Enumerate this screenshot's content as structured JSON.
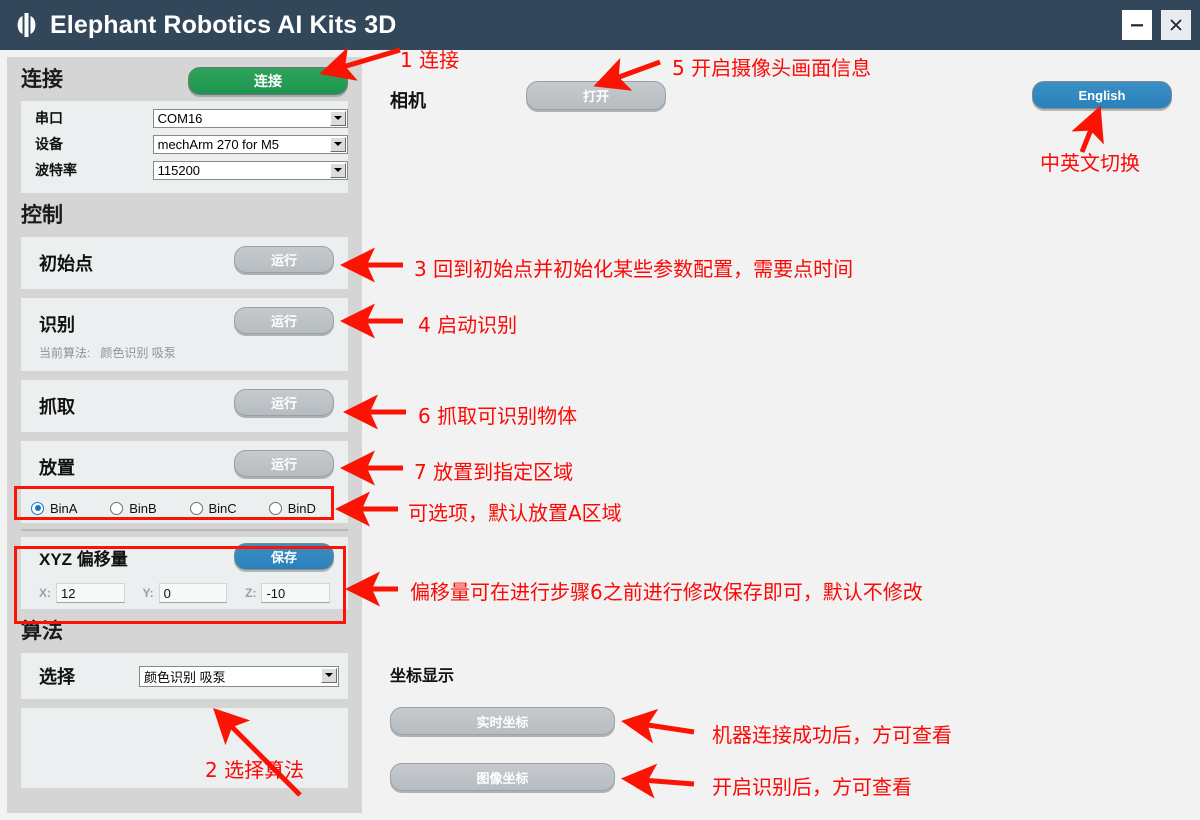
{
  "window": {
    "title": "Elephant Robotics AI Kits 3D",
    "logo_icon": "elephant-robotics-logo",
    "minimize_icon": "minimize-icon",
    "close_icon": "close-icon"
  },
  "sidebar": {
    "connection": {
      "heading": "连接",
      "connect_button": "连接",
      "fields": [
        {
          "label": "串口",
          "value": "COM16"
        },
        {
          "label": "设备",
          "value": "mechArm 270 for M5"
        },
        {
          "label": "波特率",
          "value": "115200"
        }
      ]
    },
    "control": {
      "heading": "控制",
      "run_label": "运行",
      "actions": [
        {
          "name": "初始点"
        },
        {
          "name": "识别"
        },
        {
          "name": "抓取"
        },
        {
          "name": "放置"
        }
      ],
      "current_algorithm_label": "当前算法:",
      "current_algorithm_value": "颜色识别 吸泵",
      "bins": [
        {
          "label": "BinA",
          "selected": true
        },
        {
          "label": "BinB",
          "selected": false
        },
        {
          "label": "BinC",
          "selected": false
        },
        {
          "label": "BinD",
          "selected": false
        }
      ]
    },
    "offset": {
      "heading": "XYZ 偏移量",
      "save_button": "保存",
      "x_label": "X:",
      "x_value": "12",
      "y_label": "Y:",
      "y_value": "0",
      "z_label": "Z:",
      "z_value": "-10"
    },
    "algorithm": {
      "heading": "算法",
      "select_label": "选择",
      "select_value": "颜色识别 吸泵"
    }
  },
  "main": {
    "camera_label": "相机",
    "camera_open_button": "打开",
    "language_button": "English",
    "coords_heading": "坐标显示",
    "realtime_coords_button": "实时坐标",
    "image_coords_button": "图像坐标"
  },
  "annotations": [
    {
      "id": "a1",
      "text": "1 连接"
    },
    {
      "id": "a5",
      "text": "5 开启摄像头画面信息"
    },
    {
      "id": "alang",
      "text": "中英文切换"
    },
    {
      "id": "a3",
      "text": "3 回到初始点并初始化某些参数配置，需要点时间"
    },
    {
      "id": "a4",
      "text": "4 启动识别"
    },
    {
      "id": "a6",
      "text": "6 抓取可识别物体"
    },
    {
      "id": "a7",
      "text": "7 放置到指定区域"
    },
    {
      "id": "abin",
      "text": "可选项，默认放置A区域"
    },
    {
      "id": "aoffset",
      "text": "偏移量可在进行步骤6之前进行修改保存即可，默认不修改"
    },
    {
      "id": "a2",
      "text": "2 选择算法"
    },
    {
      "id": "areal",
      "text": "机器连接成功后，方可查看"
    },
    {
      "id": "aimg",
      "text": "开启识别后，方可查看"
    }
  ],
  "colors": {
    "titlebar": "#33475b",
    "connect_green": "#2ea35a",
    "accent_blue": "#2a81ba",
    "annotation_red": "#fb0a05",
    "sidebar_gray": "#d5d5d5",
    "panel": "#eceff0"
  }
}
